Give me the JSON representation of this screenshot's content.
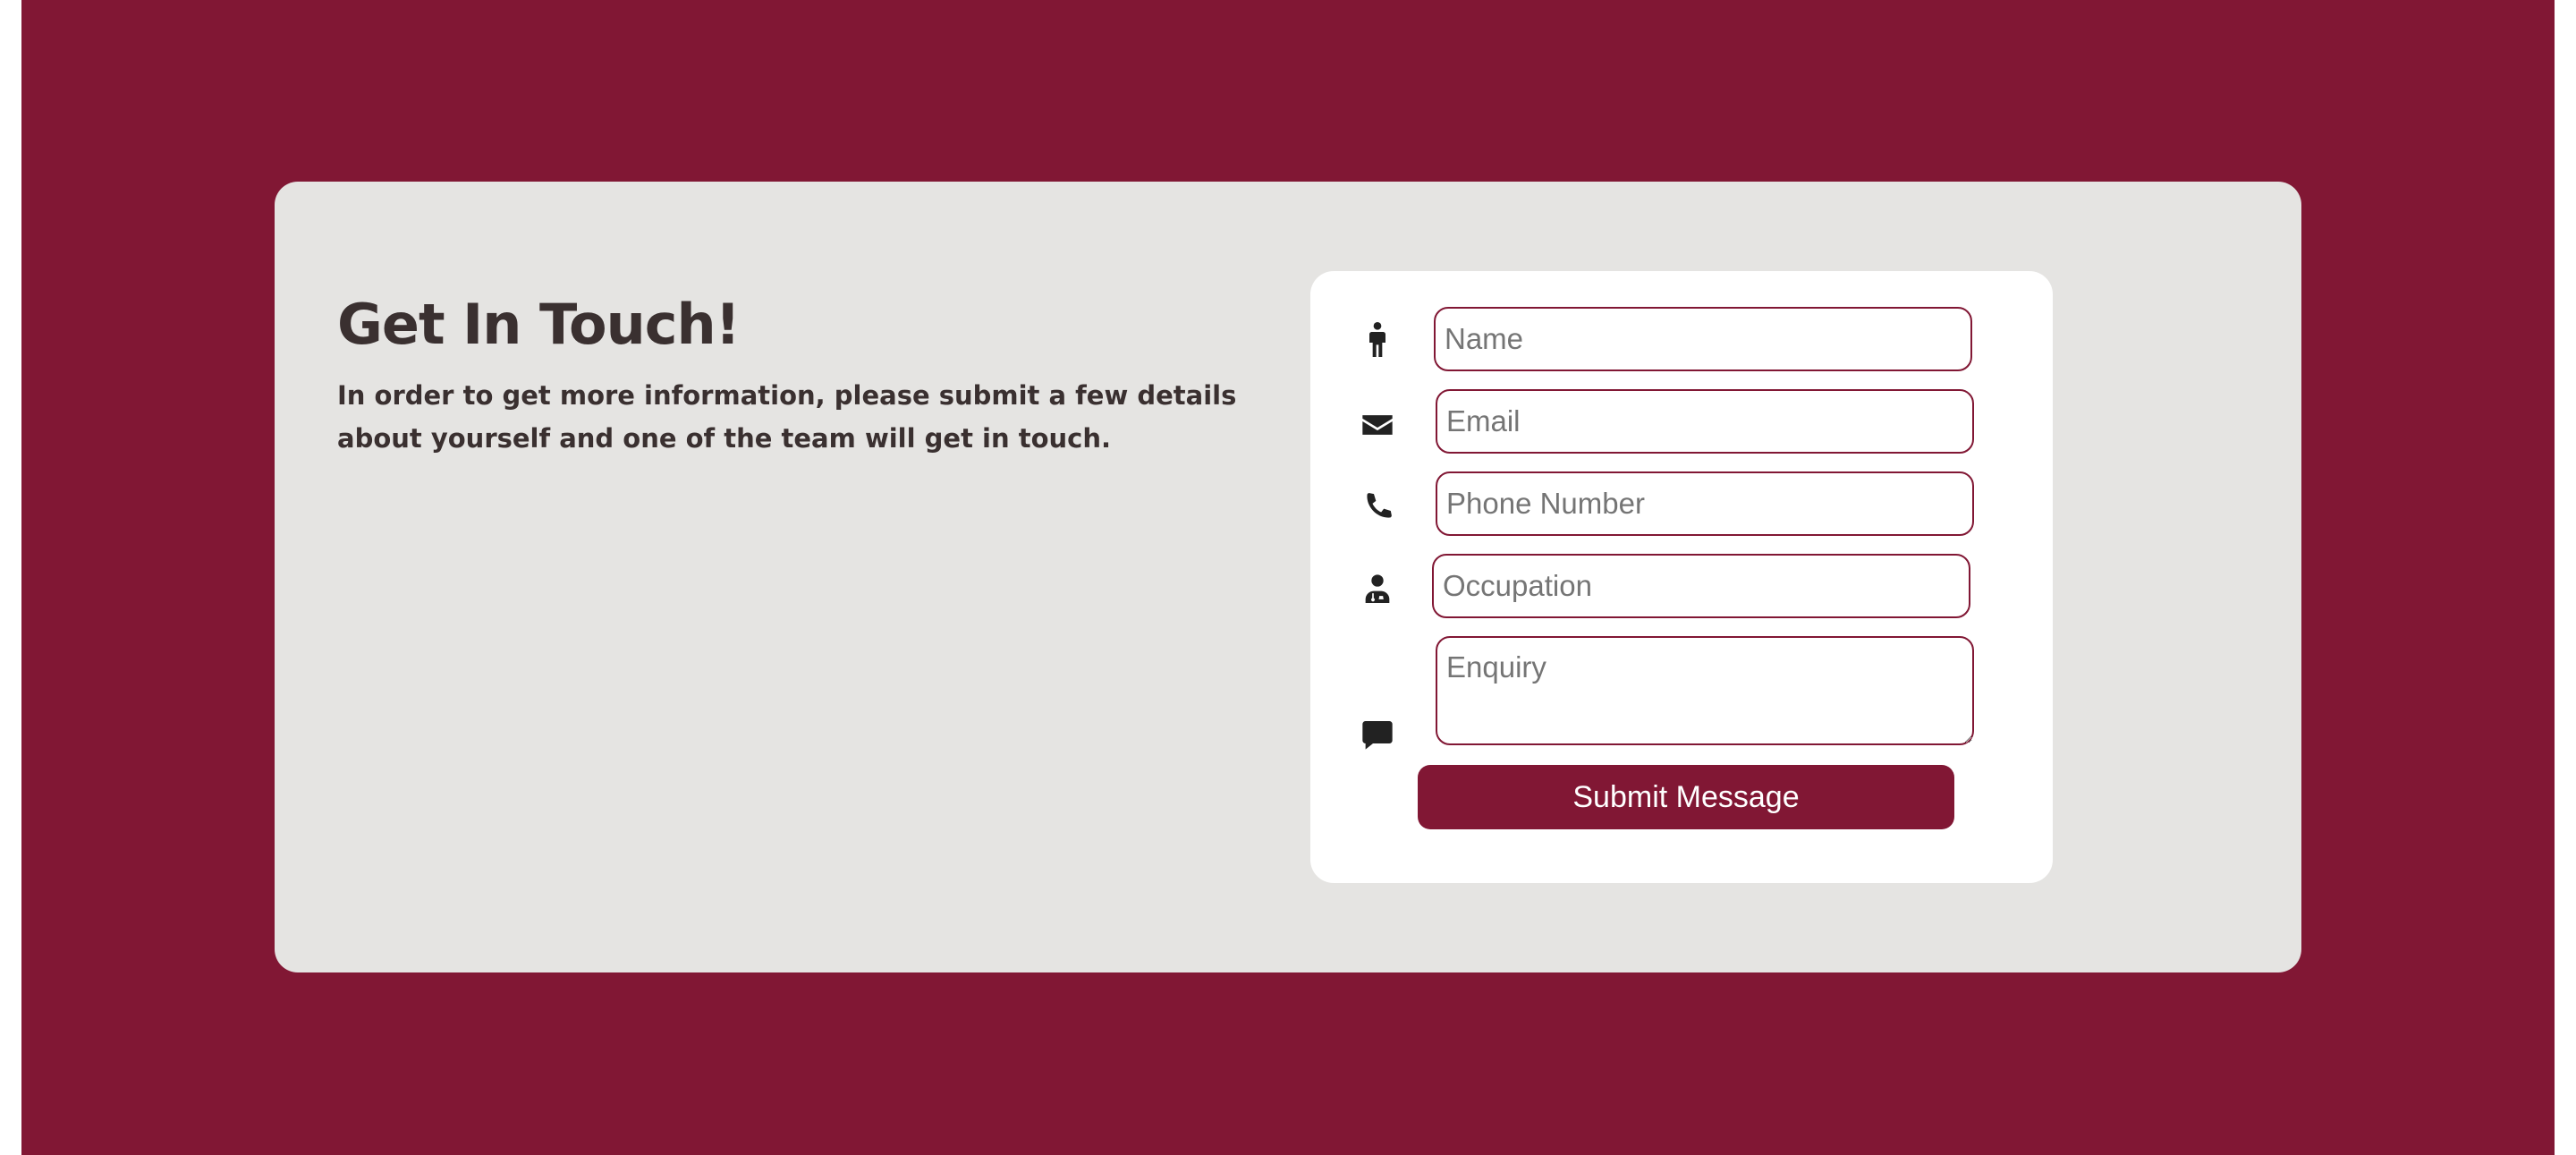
{
  "heading": "Get In Touch!",
  "intro_text": "In order to get more information, please submit a few details about yourself and one of the team will get in touch.",
  "form": {
    "name_placeholder": "Name",
    "email_placeholder": "Email",
    "phone_placeholder": "Phone Number",
    "occupation_placeholder": "Occupation",
    "enquiry_placeholder": "Enquiry",
    "submit_label": "Submit Message"
  },
  "icons": {
    "name": "person-icon",
    "email": "envelope-icon",
    "phone": "phone-icon",
    "occupation": "doctor-icon",
    "enquiry": "message-icon"
  },
  "colors": {
    "brand": "#811734",
    "card_background": "#e5e4e2",
    "panel_background": "#ffffff",
    "text": "#3a3030"
  }
}
